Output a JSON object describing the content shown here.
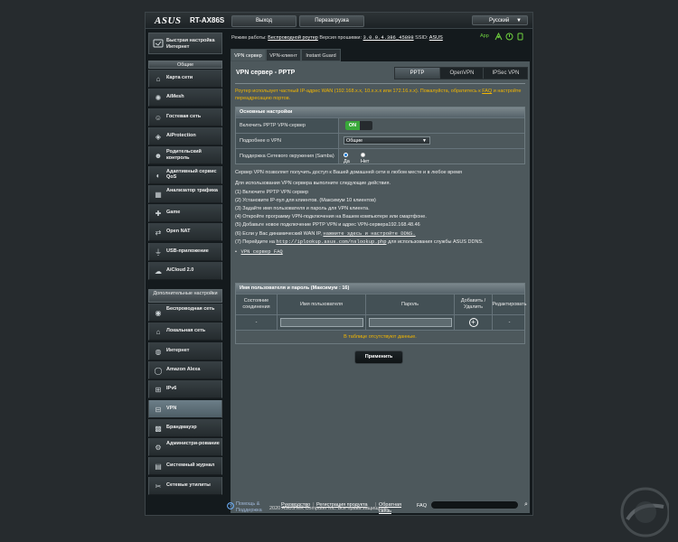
{
  "header": {
    "logo": "ASUS",
    "model": "RT-AX86S",
    "logout": "Выход",
    "reboot": "Перезагрузка",
    "language": "Русский"
  },
  "status": {
    "mode_label": "Режим работы:",
    "mode_value": "Беспроводной роутер",
    "fw_label": "Версия прошивки:",
    "fw_value": "3.0.0.4.386_45898",
    "ssid_label": "SSID:",
    "ssid_value": "ASUS",
    "app": "App"
  },
  "sidebar": {
    "quick_setup": "Быстрая настройка Интернет",
    "general_head": "Общие",
    "general": [
      {
        "label": "Карта сети",
        "icon": "network-map-icon"
      },
      {
        "label": "AiMesh",
        "icon": "aimesh-icon"
      },
      {
        "label": "Гостевая сеть",
        "icon": "guest-network-icon"
      },
      {
        "label": "AiProtection",
        "icon": "shield-icon"
      },
      {
        "label": "Родительский контроль",
        "icon": "parental-control-icon"
      },
      {
        "label": "Адаптивный сервис QoS",
        "icon": "qos-icon"
      },
      {
        "label": "Анализатор трафика",
        "icon": "traffic-analyzer-icon"
      },
      {
        "label": "Game",
        "icon": "gamepad-icon"
      },
      {
        "label": "Open NAT",
        "icon": "open-nat-icon"
      },
      {
        "label": "USB-приложение",
        "icon": "usb-icon"
      },
      {
        "label": "AiCloud 2.0",
        "icon": "cloud-icon"
      }
    ],
    "advanced_head": "Дополнительные настройки",
    "advanced": [
      {
        "label": "Беспроводная сеть",
        "icon": "wireless-icon"
      },
      {
        "label": "Локальная сеть",
        "icon": "lan-icon"
      },
      {
        "label": "Интернет",
        "icon": "globe-icon"
      },
      {
        "label": "Amazon Alexa",
        "icon": "alexa-icon"
      },
      {
        "label": "IPv6",
        "icon": "ipv6-icon"
      },
      {
        "label": "VPN",
        "icon": "vpn-icon"
      },
      {
        "label": "Брандмауэр",
        "icon": "firewall-icon"
      },
      {
        "label": "Администри-рование",
        "icon": "administration-icon"
      },
      {
        "label": "Системный журнал",
        "icon": "system-log-icon"
      },
      {
        "label": "Сетевые утилиты",
        "icon": "network-tools-icon"
      }
    ]
  },
  "tabs": [
    "VPN сервер",
    "VPN-клиент",
    "Instant Guard"
  ],
  "panel": {
    "title": "VPN сервер - PPTP",
    "protocols": [
      "PPTP",
      "OpenVPN",
      "IPSec VPN"
    ],
    "warning": "Роутер использует частный IP-адрес WAN (192.168.x.x, 10.x.x.x или 172.16.x.x). Пожалуйста, обратитесь к",
    "warning_faq": "FAQ",
    "warning_end": "и настройте переадресацию портов.",
    "basic_head": "Основные настройки",
    "enable_label": "Включить PPTP VPN-сервер",
    "enable_value": "ON",
    "details_label": "Подробнее о VPN",
    "details_value": "Общие",
    "samba_label": "Поддержка Сетевого окружения (Samba)",
    "samba_yes": "Да",
    "samba_no": "Нет"
  },
  "info": {
    "intro": "Сервер VPN позволяет получить доступ к Вашей домашней сети в любом месте и в любое время",
    "steps_head": "Для использования VPN сервера выполните следующие действия.",
    "s1": "(1) Включите PPTP VPN сервер",
    "s2": "(2) Установите IP-пул для клиентов. (Максимум 10 клиентов)",
    "s3": "(3) Задайте имя пользователя и пароль для VPN клиента.",
    "s4": "(4) Откройте программу VPN-подключения на Вашем компьютере или смартфоне.",
    "s5": "(5) Добавьте новое подключение PPTP VPN и адрес VPN-сервера192.168.48.46",
    "s6_pre": "(6) Если у Вас динамический WAN IP,",
    "s6_link": "нажмите здесь и настройте DDNS.",
    "s7_pre": "(7) Перейдите на",
    "s7_link": "http://iplookup.asus.com/nslookup.php",
    "s7_post": "для использования службы ASUS DDNS.",
    "faq_link": "VPN сервер FAQ"
  },
  "users": {
    "head": "Имя пользователя и пароль (Максимум : 16)",
    "col_status": "Состояние соединения",
    "col_user": "Имя пользователя",
    "col_pass": "Пароль",
    "col_add": "Добавить / Удалить",
    "col_edit": "Редактировать",
    "row_status": "-",
    "row_edit": "-",
    "nodata": "В таблице отсутствуют данные."
  },
  "apply": "Применить",
  "footer": {
    "help": "Помощь & Поддержка",
    "manual": "Руководство",
    "register": "Регистрация продукта",
    "feedback": "Обратная связь",
    "faq": "FAQ",
    "copyright": "2020 ASUSTeK Computer Inc. Все права защищены."
  },
  "colors": {
    "accent": "#6fd13f",
    "warning": "#f2b600",
    "toggle_on": "#39a83a"
  }
}
